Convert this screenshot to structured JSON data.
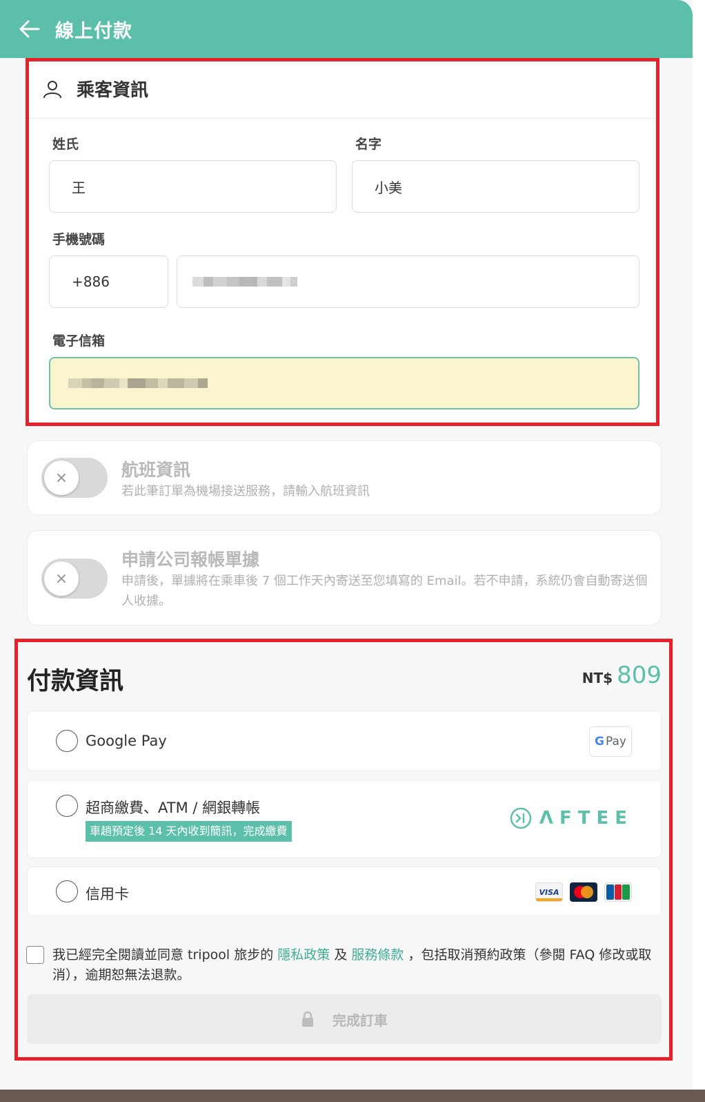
{
  "header": {
    "title": "線上付款"
  },
  "passenger": {
    "title": "乘客資訊",
    "last_name_label": "姓氏",
    "last_name_value": "王",
    "first_name_label": "名字",
    "first_name_value": "小美",
    "phone_label": "手機號碼",
    "country_code": "+886",
    "email_label": "電子信箱"
  },
  "flight": {
    "title": "航班資訊",
    "desc": "若此筆訂單為機場接送服務，請輸入航班資訊"
  },
  "receipt": {
    "title": "申請公司報帳單據",
    "desc": "申請後，單據將在乘車後 7 個工作天內寄送至您填寫的 Email。若不申請，系統仍會自動寄送個人收據。"
  },
  "payment": {
    "title": "付款資訊",
    "currency": "NT$",
    "amount": "809",
    "options": [
      {
        "label": "Google Pay",
        "logo_g": "G",
        "logo_text": "Pay"
      },
      {
        "label": "超商繳費、ATM / 網銀轉帳",
        "badge": "車趟預定後 14 天內收到簡訊，完成繳費",
        "logo_text": "ΛFTEE"
      },
      {
        "label": "信用卡",
        "card_visa": "VISA"
      }
    ]
  },
  "agreement": {
    "text_1": "我已經完全閱讀並同意 tripool 旅步的",
    "privacy_link": "隱私政策",
    "and": "及",
    "terms_link": "服務條款",
    "text_2": "，包括取消預約政策（參閱 FAQ 修改或取消），逾期恕無法退款。"
  },
  "submit_label": "完成訂車",
  "colors": {
    "brand": "#5bbfa9",
    "annotation": "#e8202a",
    "email_bg": "#faf4cf"
  }
}
